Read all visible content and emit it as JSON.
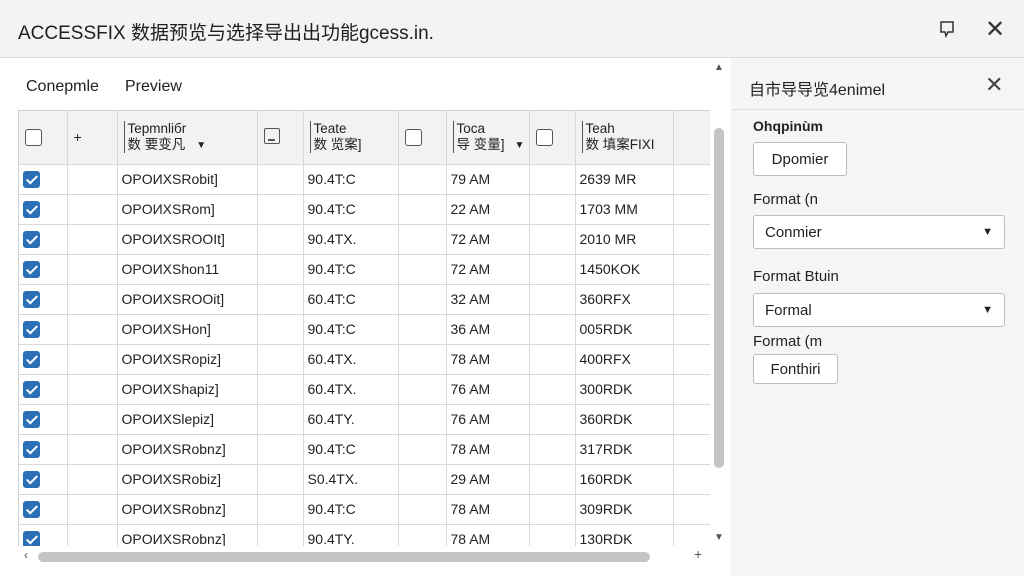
{
  "window": {
    "title": "ACCESSFIX 数据预览与选择导出出功能gcess.in.",
    "pin_icon": "pin-icon",
    "close_icon": "close-icon"
  },
  "tabs": [
    {
      "label": "Conepmle"
    },
    {
      "label": "Preview"
    }
  ],
  "grid": {
    "headers": {
      "col1_top": "Tepmnliбr",
      "col1_bottom": "数 要变凡",
      "col2_top": "Teate",
      "col2_bottom": "数 览案]",
      "col3_top": "Toca",
      "col3_bottom": "导 变量]",
      "col4_top": "Teah",
      "col4_bottom": "数 填案FIXI"
    },
    "rows": [
      {
        "a": "OPOИXЅRobit]",
        "b": "90.4T:C",
        "c": "79 AM",
        "d": "2639 MR"
      },
      {
        "a": "OPOИXЅRom]",
        "b": "90.4T:C",
        "c": "22 AM",
        "d": "1703 MM"
      },
      {
        "a": "OPOИXЅROOIt]",
        "b": "90.4TX.",
        "c": "72 AM",
        "d": "2010 MR"
      },
      {
        "a": "OPOИXЅhon11",
        "b": "90.4T:C",
        "c": "72 AM",
        "d": "1450KOK"
      },
      {
        "a": "OPOИXЅROOit]",
        "b": "60.4T:C",
        "c": "32 AM",
        "d": "360RFX"
      },
      {
        "a": "OPOИXЅHon]",
        "b": "90.4T:C",
        "c": "36 AM",
        "d": "005RDK"
      },
      {
        "a": "OPOИXЅRopiz]",
        "b": "60.4TX.",
        "c": "78 AM",
        "d": "400RFX"
      },
      {
        "a": "OPOИXЅhapiz]",
        "b": "60.4TX.",
        "c": "76 AM",
        "d": "300RDK"
      },
      {
        "a": "OPOИXЅlepiz]",
        "b": "60.4TY.",
        "c": "76 AM",
        "d": "360RDK"
      },
      {
        "a": "OPOИXЅRobnz]",
        "b": "90.4T:C",
        "c": "78 AM",
        "d": "317RDK"
      },
      {
        "a": "OPOИXЅRobiz]",
        "b": "S0.4TX.",
        "c": "29 AM",
        "d": "160RDK"
      },
      {
        "a": "OPOИXЅRobnz]",
        "b": "90.4T:C",
        "c": "78 AM",
        "d": "309RDK"
      },
      {
        "a": "OPOИXЅRobnz]",
        "b": "90.4TY.",
        "c": "78 AM",
        "d": "130RDK"
      }
    ]
  },
  "panel": {
    "title": "自市导导览4enimel",
    "section_title": "Ohqpinùm",
    "button1": "Dpomier",
    "label1": "Format  (n",
    "select1": "Conmier",
    "label2": "Format Btuin",
    "select2": "Formal",
    "label3": "Format  (m",
    "button2": "Fonthiri"
  }
}
